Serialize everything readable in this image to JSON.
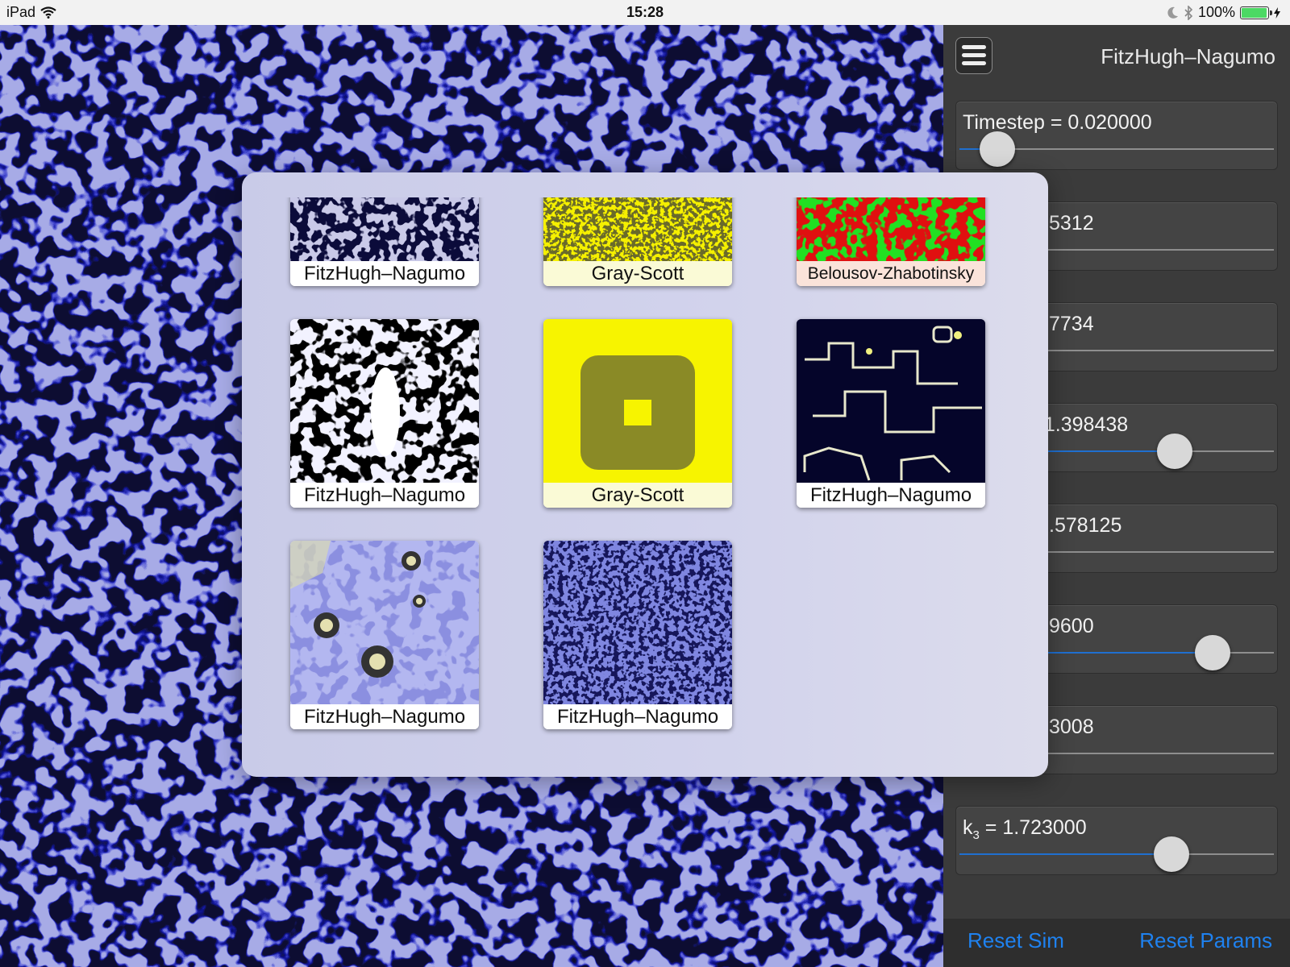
{
  "status_bar": {
    "device": "iPad",
    "time": "15:28",
    "battery_text": "100%",
    "battery_level": 1.0,
    "icons": [
      "wifi-icon",
      "moon-icon",
      "bluetooth-icon",
      "battery-icon",
      "charging-icon"
    ]
  },
  "panel": {
    "title": "FitzHugh–Nagumo",
    "menu_icon": "hamburger-icon",
    "accent_color": "#1f6fd0",
    "sliders": [
      {
        "label": "Timestep = 0.020000",
        "value": 0.12
      },
      {
        "label": "5312",
        "value": null
      },
      {
        "label": "7734",
        "value": null
      },
      {
        "label": ": 1.398438",
        "value": 0.68
      },
      {
        "label": ".578125",
        "value": null
      },
      {
        "label": "9600",
        "value": 0.8
      },
      {
        "label": "3008",
        "value": null
      },
      {
        "label_main": "k",
        "label_sub": "3",
        "label_rest": " = 1.723000",
        "value": 0.67
      }
    ],
    "reset_sim": "Reset Sim",
    "reset_params": "Reset Params"
  },
  "popover": {
    "presets": [
      {
        "name": "FitzHugh–Nagumo",
        "style": "spirals-dark"
      },
      {
        "name": "Gray-Scott",
        "style": "yellow-labyrinth"
      },
      {
        "name": "Belousov-Zhabotinsky",
        "style": "red-green"
      },
      {
        "name": "FitzHugh–Nagumo",
        "style": "white-blobs"
      },
      {
        "name": "Gray-Scott",
        "style": "yellow-square"
      },
      {
        "name": "FitzHugh–Nagumo",
        "style": "dark-cells"
      },
      {
        "name": "FitzHugh–Nagumo",
        "style": "lavender-spots"
      },
      {
        "name": "FitzHugh–Nagumo",
        "style": "blue-maze"
      }
    ]
  }
}
